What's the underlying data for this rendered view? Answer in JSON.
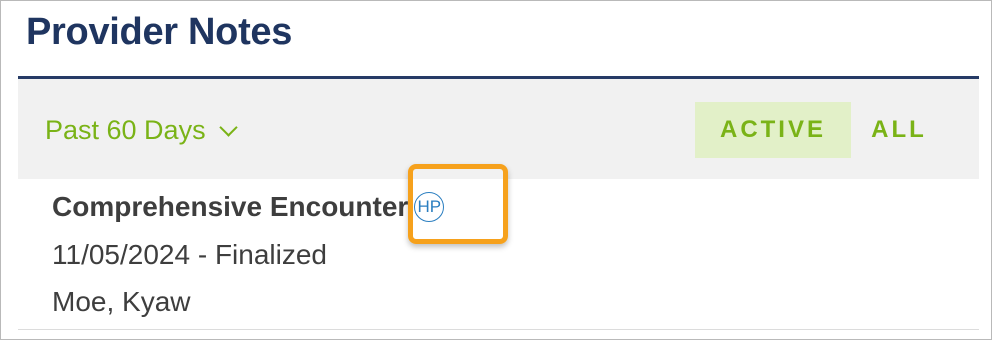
{
  "header": {
    "title": "Provider Notes"
  },
  "filters": {
    "range_label": "Past 60 Days",
    "tabs": [
      {
        "label": "ACTIVE",
        "selected": true
      },
      {
        "label": "ALL",
        "selected": false
      }
    ]
  },
  "notes": [
    {
      "title": "Comprehensive Encounter",
      "badge": "HP",
      "date_status": "11/05/2024 - Finalized",
      "author": "Moe, Kyaw"
    }
  ],
  "colors": {
    "title": "#1f3560",
    "accent_green": "#7ab317",
    "active_tab_bg": "#e2f0c8",
    "badge_blue": "#2a7ec0",
    "callout_orange": "#f6a11c"
  },
  "icons": {
    "range_toggle": "chevron-down-icon",
    "callout": "highlight-callout"
  }
}
